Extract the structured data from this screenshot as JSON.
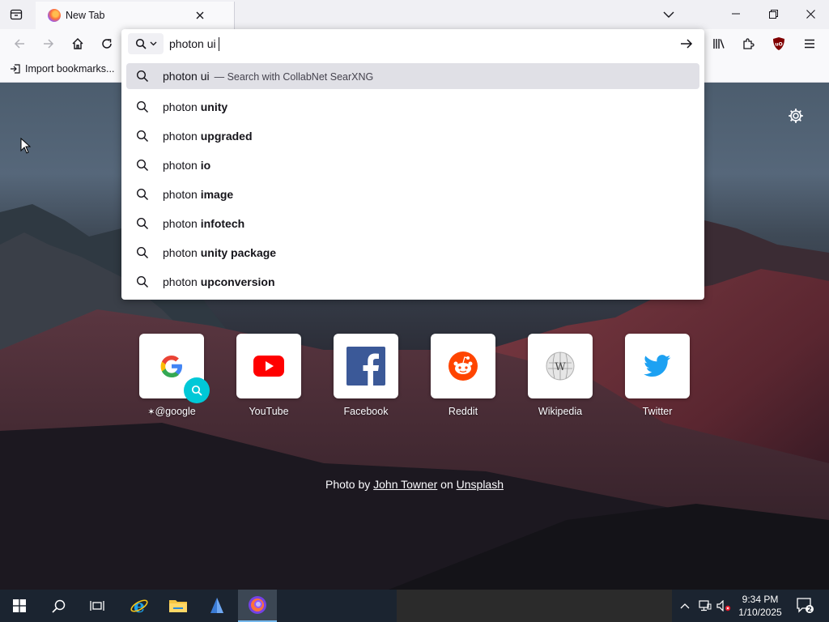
{
  "browser": {
    "tab": {
      "title": "New Tab"
    },
    "bookmarks": {
      "import_label": "Import bookmarks..."
    },
    "url": {
      "typed": "photon ui",
      "results": [
        {
          "prefix": "photon ui",
          "bold": "",
          "hint_sep": "—",
          "hint": "Search with CollabNet SearXNG",
          "selected": true
        },
        {
          "prefix": "photon ",
          "bold": "unity"
        },
        {
          "prefix": "photon ",
          "bold": "upgraded"
        },
        {
          "prefix": "photon ",
          "bold": "io"
        },
        {
          "prefix": "photon ",
          "bold": "image"
        },
        {
          "prefix": "photon ",
          "bold": "infotech"
        },
        {
          "prefix": "photon ",
          "bold": "unity package"
        },
        {
          "prefix": "photon ",
          "bold": "upconversion"
        }
      ]
    }
  },
  "newtab": {
    "shortcuts": [
      {
        "label": "@google",
        "icon": "google-icon"
      },
      {
        "label": "YouTube",
        "icon": "youtube-icon"
      },
      {
        "label": "Facebook",
        "icon": "facebook-icon"
      },
      {
        "label": "Reddit",
        "icon": "reddit-icon"
      },
      {
        "label": "Wikipedia",
        "icon": "wikipedia-icon"
      },
      {
        "label": "Twitter",
        "icon": "twitter-icon"
      }
    ],
    "credit": {
      "prefix": "Photo by",
      "author": "John Towner",
      "mid": "on",
      "site": "Unsplash"
    }
  },
  "taskbar": {
    "time": "9:34 PM",
    "date": "1/10/2025",
    "notifications_count": "2"
  },
  "colors": {
    "accent_cyan": "#00c8d7",
    "toolbar_bg": "#f9f9fb",
    "tab_strip_bg": "#f0f0f4",
    "taskbar_bg": "#1b2430",
    "ublock_red": "#800000"
  }
}
